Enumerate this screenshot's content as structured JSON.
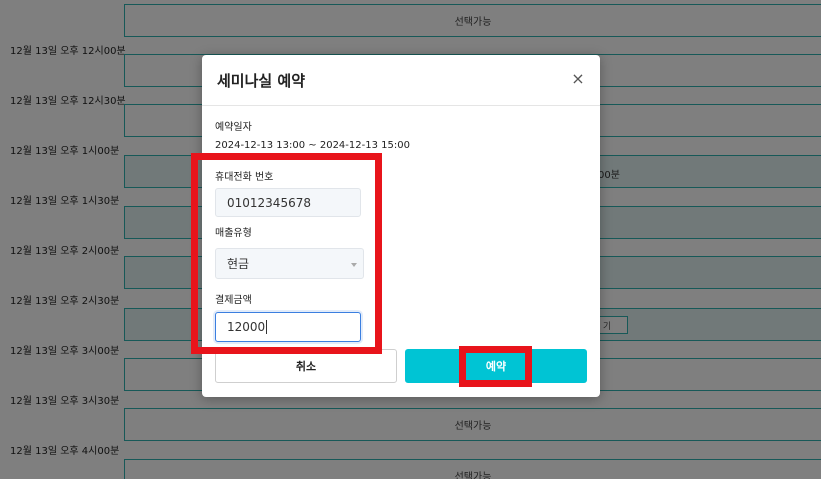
{
  "schedule": {
    "rows": [
      {
        "time": "",
        "slot": "선택가능"
      },
      {
        "time": "12월 13일 오후 12시00분",
        "slot": ""
      },
      {
        "time": "12월 13일 오후 12시30분",
        "slot": ""
      },
      {
        "time": "12월 13일 오후 1시00분",
        "slot": ""
      },
      {
        "time": "12월 13일 오후 1시30분",
        "slot": ""
      },
      {
        "time": "12월 13일 오후 2시00분",
        "slot": ""
      },
      {
        "time": "12월 13일 오후 2시30분",
        "slot": ""
      },
      {
        "time": "12월 13일 오후 3시00분",
        "slot": ""
      },
      {
        "time": "12월 13일 오후 3시30분",
        "slot": "선택가능"
      },
      {
        "time": "12월 13일 오후 4시00분",
        "slot": "선택가능"
      }
    ],
    "partial_text_1": "00분",
    "partial_text_2": "기"
  },
  "modal": {
    "title": "세미나실 예약",
    "close": "×",
    "date_label": "예약일자",
    "date_value": "2024-12-13 13:00 ~ 2024-12-13 15:00",
    "phone_label": "휴대전화 번호",
    "phone_value": "01012345678",
    "sales_type_label": "매출유형",
    "sales_type_value": "현금",
    "amount_label": "결제금액",
    "amount_value": "12000",
    "cancel_label": "취소",
    "reserve_label": "예약"
  },
  "colors": {
    "accent": "#00c4d4",
    "highlight": "#e8141b",
    "slot_border": "#2fb3b0"
  }
}
